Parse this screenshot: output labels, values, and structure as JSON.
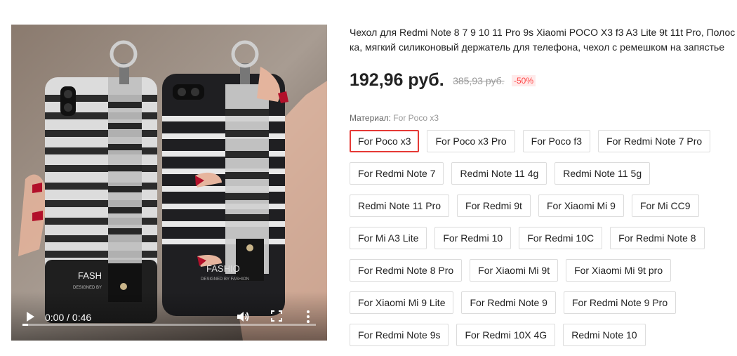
{
  "video": {
    "time": "0:00 / 0:46",
    "progress": 0.02,
    "case_left_brand": "FASH",
    "case_left_sub": "DESIGNED BY",
    "case_right_brand": "FASHIO",
    "case_right_sub": "DESIGNED BY FASHION"
  },
  "product": {
    "title_line1": "Чехол для Redmi Note 8 7 9 10 11 Pro 9s Xiaomi POCO X3 f3 A3 Lite 9t 11t Pro, Полос",
    "title_line2": "ка, мягкий силиконовый держатель для телефона, чехол с ремешком на запястье",
    "price": "192,96 руб.",
    "old_price": "385,93 руб.",
    "discount": "-50%"
  },
  "variant": {
    "label": "Материал:",
    "selected": "For Poco x3",
    "options": [
      "For Poco x3",
      "For Poco x3 Pro",
      "For Poco f3",
      "For Redmi Note 7 Pro",
      "For Redmi Note 7",
      "Redmi Note 11 4g",
      "Redmi Note 11 5g",
      "Redmi Note 11 Pro",
      "For Redmi 9t",
      "For Xiaomi Mi 9",
      "For Mi CC9",
      "For Mi A3 Lite",
      "For Redmi 10",
      "For Redmi 10C",
      "For Redmi Note 8",
      "For Redmi Note 8 Pro",
      "For Xiaomi Mi 9t",
      "For Xiaomi Mi 9t pro",
      "For Xiaomi Mi 9 Lite",
      "For Redmi Note 9",
      "For Redmi Note 9 Pro",
      "For Redmi Note 9s",
      "For Redmi 10X 4G",
      "Redmi Note 10"
    ]
  },
  "colors": {
    "accent": "#e53935",
    "discount": "#ff4747",
    "border": "#dcdcdc"
  }
}
